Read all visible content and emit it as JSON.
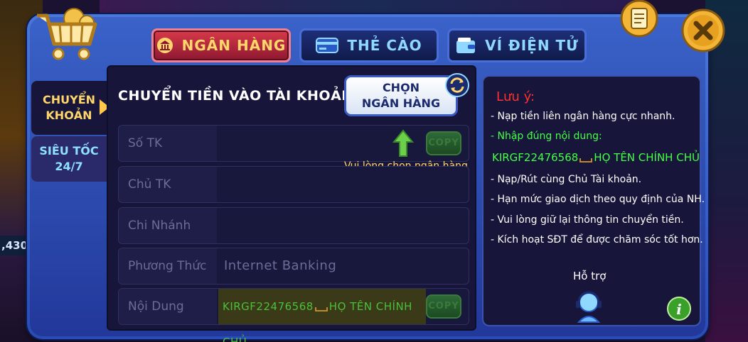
{
  "tabs": {
    "bank": "NGÂN HÀNG",
    "card": "THẺ CÀO",
    "wallet": "VÍ ĐIỆN TỬ"
  },
  "sidebar": {
    "transfer_line1": "CHUYỂN",
    "transfer_line2": "KHOẢN",
    "fast_line1": "SIÊU TỐC",
    "fast_line2": "24/7"
  },
  "main": {
    "heading": "CHUYỂN TIỀN VÀO TÀI KHOẢN",
    "choose_bank_line1": "CHỌN",
    "choose_bank_line2": "NGÂN HÀNG",
    "hint": "Vui lòng chọn ngân hàng",
    "copy_label": "COPY",
    "fields": {
      "account_no": {
        "label": "Số TK",
        "value": ""
      },
      "account_holder": {
        "label": "Chủ TK",
        "value": ""
      },
      "branch": {
        "label": "Chi Nhánh",
        "value": ""
      },
      "method": {
        "label": "Phương Thức",
        "value": "Internet Banking"
      },
      "content": {
        "label": "Nội Dung",
        "code": "KIRGF22476568",
        "name": "HỌ TÊN CHÍNH CHỦ"
      }
    }
  },
  "notes": {
    "title": "Lưu ý:",
    "line1": "- Nạp tiền liên ngân hàng cực nhanh.",
    "line2": "- Nhập đúng nội dung:",
    "code": "KIRGF22476568",
    "code_name": "HỌ TÊN CHÍNH CHỦ",
    "line3": "- Nạp/Rút cùng Chủ Tài khoản.",
    "line4": "- Hạn mức giao dịch theo quy định của NH.",
    "line5": "- Vui lòng giữ lại thông tin chuyển tiền.",
    "line6": "- Kích hoạt SĐT để được chăm sóc tốt hơn."
  },
  "support": {
    "label": "Hỗ trợ"
  },
  "background": {
    "balance_fragment": ",430"
  },
  "colors": {
    "accent_gold": "#ffd66a",
    "active_tab": "#d93a4a",
    "note_title": "#ff3030",
    "note_green": "#44ff44"
  }
}
